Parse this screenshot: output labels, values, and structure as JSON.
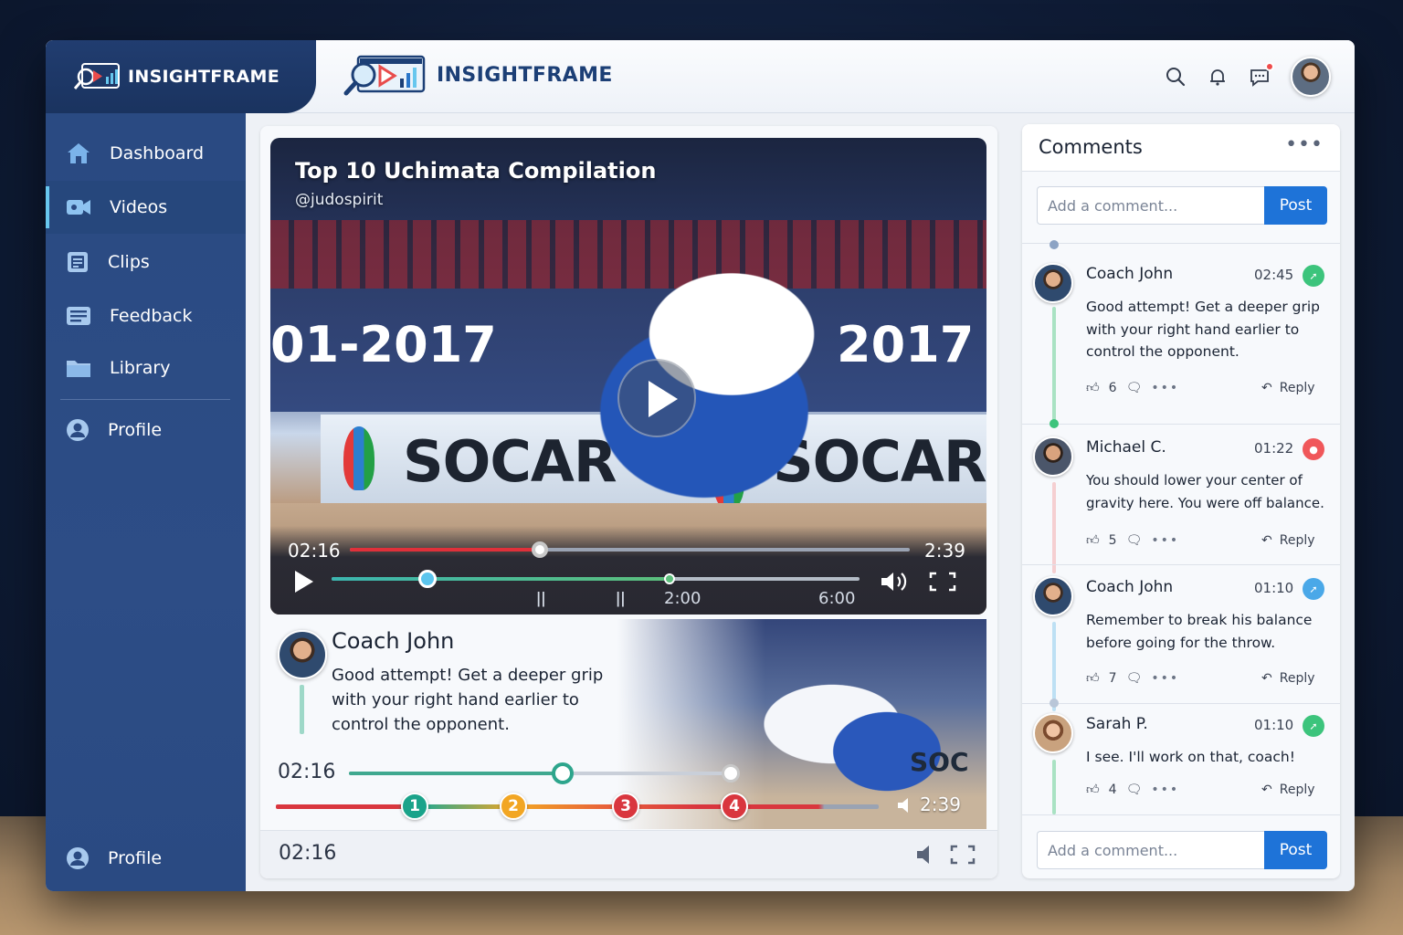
{
  "brand": {
    "sidebar_name": "INSIGHTFRAME",
    "header_name": "INSIGHTFRAME",
    "primary_color": "#1c3f76",
    "accent_color": "#1e73d8"
  },
  "header": {
    "icons": [
      "search-icon",
      "bell-icon",
      "chat-icon",
      "avatar"
    ]
  },
  "sidebar": {
    "items": [
      {
        "label": "Dashboard",
        "icon": "home-icon"
      },
      {
        "label": "Videos",
        "icon": "video-camera-icon",
        "active": true
      },
      {
        "label": "Clips",
        "icon": "clips-icon"
      },
      {
        "label": "Feedback",
        "icon": "feedback-icon"
      },
      {
        "label": "Library",
        "icon": "folder-icon"
      },
      {
        "label": "Profile",
        "icon": "profile-icon"
      }
    ],
    "footer_label": "Profile"
  },
  "video": {
    "title": "Top 10 Uchimata Compilation",
    "handle": "@judospirit",
    "current_time": "02:16",
    "duration": "2:39",
    "progress_fraction": 0.34,
    "segment_labels": [
      "2:00",
      "6:00"
    ],
    "scene": {
      "year_text_left": "01-2017",
      "year_text_right": "2017",
      "sponsor_left": "SOCAR",
      "sponsor_right": "SOCAR"
    }
  },
  "coach_comment": {
    "name": "Coach John",
    "text": "Good attempt! Get a deeper grip with your right hand earlier to control the opponent.",
    "time": "02:16",
    "end_time": "2:39",
    "markers": [
      "1",
      "2",
      "3",
      "4"
    ],
    "marker_colors": [
      "#1aa38a",
      "#f2a623",
      "#d9363e",
      "#d9363e"
    ],
    "bg_sponsor": "SOC"
  },
  "footer": {
    "time": "02:16"
  },
  "comments": {
    "title": "Comments",
    "more": "•••",
    "input_placeholder": "Add a comment...",
    "post_label": "Post",
    "reply_label": "Reply",
    "items": [
      {
        "name": "Coach John",
        "time": "02:45",
        "text": "Good attempt! Get a deeper grip with your right hand earlier to control the opponent.",
        "likes": "6",
        "badge_color": "#3cc47c",
        "line_color": "#a9e2c3"
      },
      {
        "name": "Michael C.",
        "time": "01:22",
        "text": "You should lower your center of gravity here. You were off balance.",
        "likes": "5",
        "badge_color": "#f0575a",
        "line_color": "#f5cfd1"
      },
      {
        "name": "Coach John",
        "time": "01:10",
        "text": "Remember to break his balance before going for the throw.",
        "likes": "7",
        "badge_color": "#4aa8e8",
        "line_color": "#bde0f4"
      },
      {
        "name": "Sarah P.",
        "time": "01:10",
        "text": "I see. I'll work on that, coach!",
        "likes": "4",
        "badge_color": "#3cc47c",
        "line_color": "#a9e2c3"
      }
    ]
  }
}
